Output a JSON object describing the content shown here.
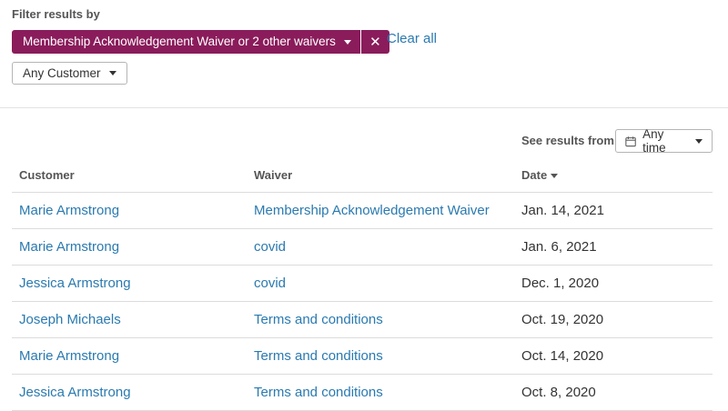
{
  "filters": {
    "heading": "Filter results by",
    "waiver_chip_label": "Membership Acknowledgement Waiver or 2 other waivers",
    "clear_all_label": "Clear all",
    "customer_dropdown_label": "Any Customer"
  },
  "time_filter": {
    "label": "See results from",
    "value": "Any time"
  },
  "table": {
    "headers": {
      "customer": "Customer",
      "waiver": "Waiver",
      "date": "Date"
    },
    "sort_column": "date",
    "sort_direction": "descending",
    "rows": [
      {
        "customer": "Marie Armstrong",
        "waiver": "Membership Acknowledgement Waiver",
        "date": "Jan. 14, 2021"
      },
      {
        "customer": "Marie Armstrong",
        "waiver": "covid",
        "date": "Jan. 6, 2021"
      },
      {
        "customer": "Jessica Armstrong",
        "waiver": "covid",
        "date": "Dec. 1, 2020"
      },
      {
        "customer": "Joseph Michaels",
        "waiver": "Terms and conditions",
        "date": "Oct. 19, 2020"
      },
      {
        "customer": "Marie Armstrong",
        "waiver": "Terms and conditions",
        "date": "Oct. 14, 2020"
      },
      {
        "customer": "Jessica Armstrong",
        "waiver": "Terms and conditions",
        "date": "Oct. 8, 2020"
      }
    ]
  },
  "colors": {
    "chip": "#8a1c5b",
    "link": "#2a7ab0"
  },
  "icons": {
    "chip_dropdown": "caret-down-icon",
    "chip_remove": "close-icon",
    "time": "calendar-icon",
    "sort": "sort-desc-icon"
  }
}
